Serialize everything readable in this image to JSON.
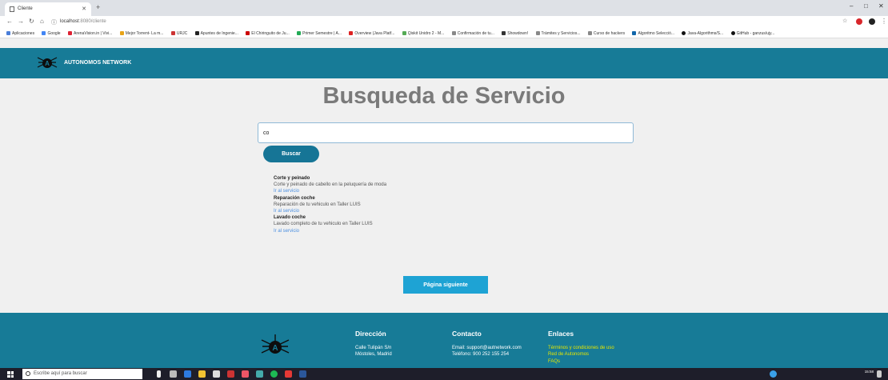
{
  "browser": {
    "tab_title": "Cliente",
    "url_host": "localhost",
    "url_path": ":8080/cliente",
    "bookmarks": [
      "Aplicaciones",
      "Google",
      "ArenaVision.in | Vivi...",
      "Mejor Torrent- La m...",
      "URJC",
      "Apuntes de Ingenie...",
      "El Chiringuito de Ju...",
      "Primer Semestre | A...",
      "Overview (Java Platf...",
      "Qiskit Unidro 2 - M...",
      "Confirmación de tu...",
      "Showdown!",
      "Trámites y Servicios...",
      "Curso de hackers",
      "Algoritmo Selecció...",
      "Java-Algorithms/S...",
      "GitHub - ganzus/ujy..."
    ]
  },
  "header": {
    "brand": "AUTONOMOS NETWORK"
  },
  "main": {
    "title": "Busqueda de Servicio",
    "search_value": "co",
    "search_button": "Buscar",
    "results": [
      {
        "name": "Corte y peinado",
        "description": "Corte y peinado de cabello en la peluquería de moda",
        "link": "Ir al servicio"
      },
      {
        "name": "Reparación coche",
        "description": "Reparación de tu vehiculo en Taller LUIS",
        "link": "Ir al servicio"
      },
      {
        "name": "Lavado coche",
        "description": "Lavado completo de tu vehiculo en Taller LUIS",
        "link": "Ir al servicio"
      }
    ],
    "next_button": "Página siguiente"
  },
  "footer": {
    "address": {
      "heading": "Dirección",
      "line1": "Calle Tulipán S/n",
      "line2": "Móstoles, Madrid"
    },
    "contact": {
      "heading": "Contacto",
      "email": "Email: support@autnetwork.com",
      "phone": "Teléfono: 900 252 155 254"
    },
    "links": {
      "heading": "Enlaces",
      "items": [
        "Términos y condiciones de uso",
        "Red de Autonomos",
        "FAQs"
      ]
    }
  },
  "taskbar": {
    "search_placeholder": "Escribe aquí para buscar",
    "time": "15:58"
  },
  "colors": {
    "brand": "#177b97",
    "button": "#167596",
    "next_button": "#1ea3d4",
    "link": "#4b8fe0",
    "footer_link": "#e6e600"
  }
}
